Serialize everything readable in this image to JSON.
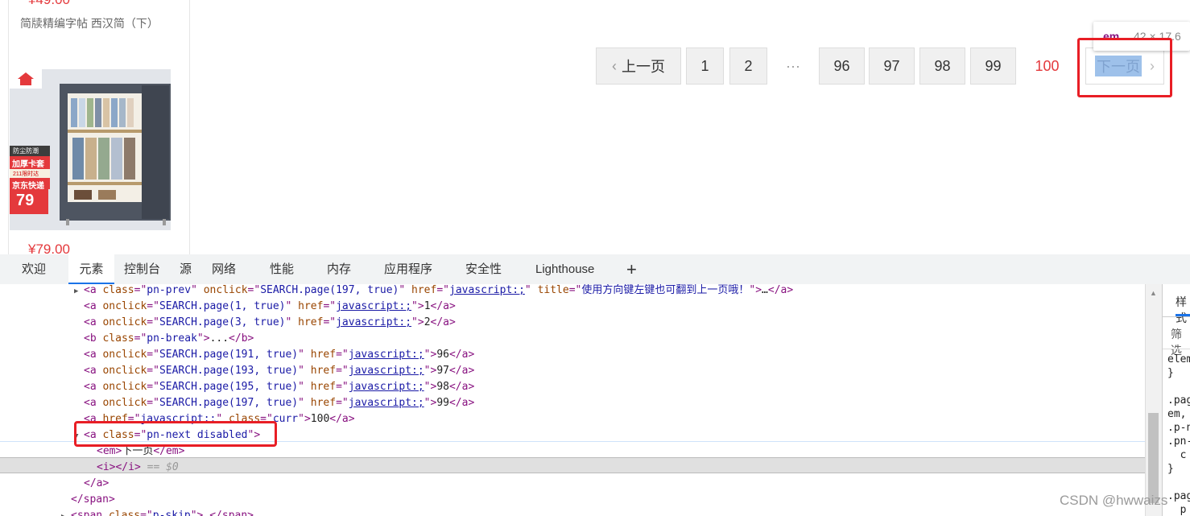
{
  "product": {
    "price_top": "¥49.00",
    "title": "简牍精编字帖 西汉简（下）",
    "image_badge_top": "防尘防潮",
    "image_badge_mid": "加厚卡套",
    "image_badge_small": "211限时达",
    "image_badge_ship": "京东快递",
    "image_price": "79",
    "price": "¥79.00"
  },
  "pagination": {
    "prev_label": "上一页",
    "pages": [
      "1",
      "2"
    ],
    "break": "···",
    "pages2": [
      "96",
      "97",
      "98",
      "99"
    ],
    "current": "100",
    "next_label": "下一页",
    "tooltip_tag": "em",
    "tooltip_size": "42 × 17.6"
  },
  "devtools": {
    "tabs": [
      "欢迎",
      "元素",
      "控制台",
      "源",
      "网络",
      "性能",
      "内存",
      "应用程序",
      "安全性",
      "Lighthouse"
    ],
    "add_tab": "+",
    "code_lines": [
      {
        "ind": 0,
        "arrow": "▶",
        "parts": [
          [
            "tag",
            "<a "
          ],
          [
            "attr",
            "class"
          ],
          [
            "tag",
            "=\""
          ],
          [
            "val",
            "pn-prev"
          ],
          [
            "tag",
            "\" "
          ],
          [
            "attr",
            "onclick"
          ],
          [
            "tag",
            "=\""
          ],
          [
            "val",
            "SEARCH.page(197, true)"
          ],
          [
            "tag",
            "\" "
          ],
          [
            "attr",
            "href"
          ],
          [
            "tag",
            "=\""
          ],
          [
            "lnk",
            "javascript:;"
          ],
          [
            "tag",
            "\" "
          ],
          [
            "attr",
            "title"
          ],
          [
            "tag",
            "=\""
          ],
          [
            "val",
            "使用方向键左键也可翻到上一页哦！"
          ],
          [
            "tag",
            "\">"
          ],
          [
            "txt",
            "…"
          ],
          [
            "tag",
            "</a>"
          ]
        ]
      },
      {
        "ind": 0,
        "arrow": "",
        "parts": [
          [
            "tag",
            "<a "
          ],
          [
            "attr",
            "onclick"
          ],
          [
            "tag",
            "=\""
          ],
          [
            "val",
            "SEARCH.page(1, true)"
          ],
          [
            "tag",
            "\" "
          ],
          [
            "attr",
            "href"
          ],
          [
            "tag",
            "=\""
          ],
          [
            "lnk",
            "javascript:;"
          ],
          [
            "tag",
            "\">"
          ],
          [
            "txt",
            "1"
          ],
          [
            "tag",
            "</a>"
          ]
        ]
      },
      {
        "ind": 0,
        "arrow": "",
        "parts": [
          [
            "tag",
            "<a "
          ],
          [
            "attr",
            "onclick"
          ],
          [
            "tag",
            "=\""
          ],
          [
            "val",
            "SEARCH.page(3, true)"
          ],
          [
            "tag",
            "\" "
          ],
          [
            "attr",
            "href"
          ],
          [
            "tag",
            "=\""
          ],
          [
            "lnk",
            "javascript:;"
          ],
          [
            "tag",
            "\">"
          ],
          [
            "txt",
            "2"
          ],
          [
            "tag",
            "</a>"
          ]
        ]
      },
      {
        "ind": 0,
        "arrow": "",
        "parts": [
          [
            "tag",
            "<b "
          ],
          [
            "attr",
            "class"
          ],
          [
            "tag",
            "=\""
          ],
          [
            "val",
            "pn-break"
          ],
          [
            "tag",
            "\">"
          ],
          [
            "txt",
            "..."
          ],
          [
            "tag",
            "</b>"
          ]
        ]
      },
      {
        "ind": 0,
        "arrow": "",
        "parts": [
          [
            "tag",
            "<a "
          ],
          [
            "attr",
            "onclick"
          ],
          [
            "tag",
            "=\""
          ],
          [
            "val",
            "SEARCH.page(191, true)"
          ],
          [
            "tag",
            "\" "
          ],
          [
            "attr",
            "href"
          ],
          [
            "tag",
            "=\""
          ],
          [
            "lnk",
            "javascript:;"
          ],
          [
            "tag",
            "\">"
          ],
          [
            "txt",
            "96"
          ],
          [
            "tag",
            "</a>"
          ]
        ]
      },
      {
        "ind": 0,
        "arrow": "",
        "parts": [
          [
            "tag",
            "<a "
          ],
          [
            "attr",
            "onclick"
          ],
          [
            "tag",
            "=\""
          ],
          [
            "val",
            "SEARCH.page(193, true)"
          ],
          [
            "tag",
            "\" "
          ],
          [
            "attr",
            "href"
          ],
          [
            "tag",
            "=\""
          ],
          [
            "lnk",
            "javascript:;"
          ],
          [
            "tag",
            "\">"
          ],
          [
            "txt",
            "97"
          ],
          [
            "tag",
            "</a>"
          ]
        ]
      },
      {
        "ind": 0,
        "arrow": "",
        "parts": [
          [
            "tag",
            "<a "
          ],
          [
            "attr",
            "onclick"
          ],
          [
            "tag",
            "=\""
          ],
          [
            "val",
            "SEARCH.page(195, true)"
          ],
          [
            "tag",
            "\" "
          ],
          [
            "attr",
            "href"
          ],
          [
            "tag",
            "=\""
          ],
          [
            "lnk",
            "javascript:;"
          ],
          [
            "tag",
            "\">"
          ],
          [
            "txt",
            "98"
          ],
          [
            "tag",
            "</a>"
          ]
        ]
      },
      {
        "ind": 0,
        "arrow": "",
        "parts": [
          [
            "tag",
            "<a "
          ],
          [
            "attr",
            "onclick"
          ],
          [
            "tag",
            "=\""
          ],
          [
            "val",
            "SEARCH.page(197, true)"
          ],
          [
            "tag",
            "\" "
          ],
          [
            "attr",
            "href"
          ],
          [
            "tag",
            "=\""
          ],
          [
            "lnk",
            "javascript:;"
          ],
          [
            "tag",
            "\">"
          ],
          [
            "txt",
            "99"
          ],
          [
            "tag",
            "</a>"
          ]
        ]
      },
      {
        "ind": 0,
        "arrow": "",
        "parts": [
          [
            "tag",
            "<a "
          ],
          [
            "attr",
            "href"
          ],
          [
            "tag",
            "=\""
          ],
          [
            "lnk",
            "javascript:;"
          ],
          [
            "tag",
            "\" "
          ],
          [
            "attr",
            "class"
          ],
          [
            "tag",
            "=\""
          ],
          [
            "val",
            "curr"
          ],
          [
            "tag",
            "\">"
          ],
          [
            "txt",
            "100"
          ],
          [
            "tag",
            "</a>"
          ]
        ]
      },
      {
        "ind": 0,
        "arrow": "▼",
        "parts": [
          [
            "tag",
            "<a "
          ],
          [
            "attr",
            "class"
          ],
          [
            "tag",
            "=\""
          ],
          [
            "val",
            "pn-next disabled"
          ],
          [
            "tag",
            "\">"
          ]
        ]
      },
      {
        "ind": 1,
        "arrow": "",
        "parts": [
          [
            "tag",
            "<em>"
          ],
          [
            "txt",
            "下一页"
          ],
          [
            "tag",
            "</em>"
          ]
        ]
      },
      {
        "ind": 1,
        "arrow": "",
        "parts": [
          [
            "tag",
            "<i>"
          ],
          [
            "tag",
            "</i>"
          ],
          [
            "gray",
            " == $0"
          ]
        ]
      },
      {
        "ind": 0,
        "arrow": "",
        "parts": [
          [
            "tag",
            "</a>"
          ]
        ]
      },
      {
        "ind": -1,
        "arrow": "",
        "parts": [
          [
            "tag",
            "</span>"
          ]
        ]
      },
      {
        "ind": -1,
        "arrow": "▶",
        "parts": [
          [
            "tag",
            "<span "
          ],
          [
            "attr",
            "class"
          ],
          [
            "tag",
            "=\""
          ],
          [
            "val",
            "p-skip"
          ],
          [
            "tag",
            "\">"
          ],
          [
            "txt",
            "…"
          ],
          [
            "tag",
            "</span>"
          ]
        ]
      }
    ],
    "styles_tab": "样式",
    "styles_filter": "筛选",
    "styles_lines": [
      "element",
      "}",
      "",
      ".page",
      "em, ",
      ".p-n",
      ".pn-",
      "  c",
      "}",
      "",
      ".pag",
      "  p"
    ]
  },
  "watermark": "CSDN @hwwaizs"
}
